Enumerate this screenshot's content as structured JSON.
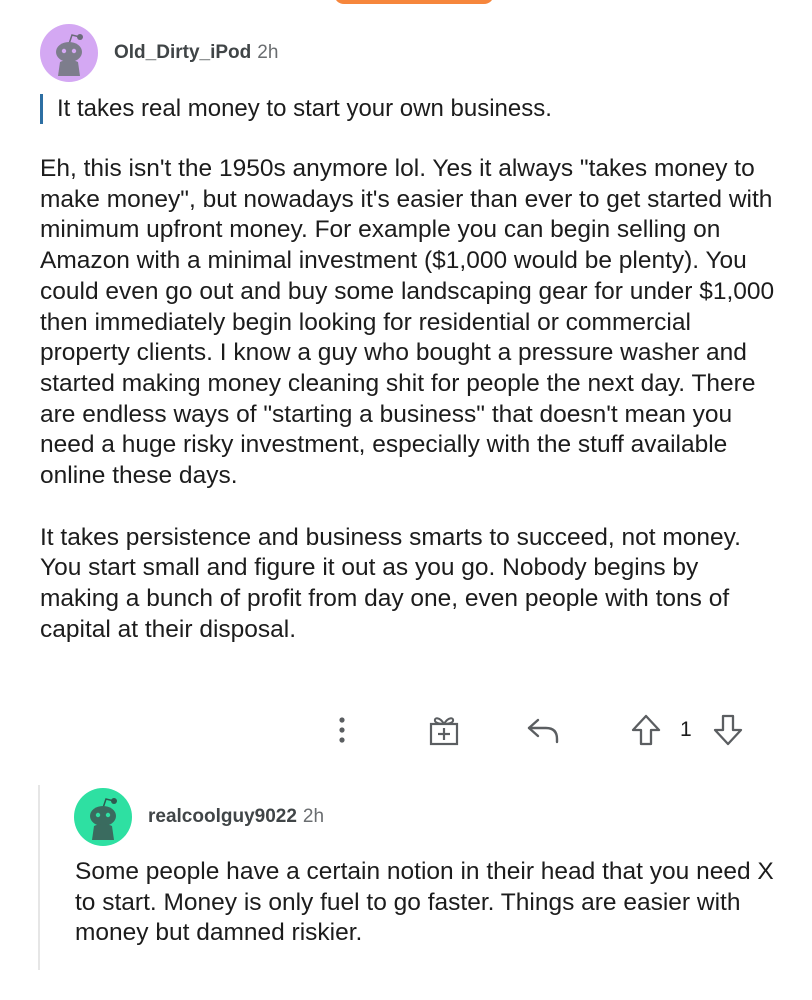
{
  "comments": [
    {
      "username": "Old_Dirty_iPod",
      "time": "2h",
      "avatar_color": "#d4a8f3",
      "quote": "It takes real money to start your own business.",
      "paragraphs": [
        "Eh, this isn't the 1950s anymore lol.  Yes it always \"takes money to make money\", but nowadays it's easier than ever to get started with minimum upfront money.  For example you can begin selling on Amazon with a minimal investment ($1,000 would be plenty).  You could even go out and buy some landscaping gear for under $1,000 then immediately begin looking for residential or commercial property clients.  I know a guy who bought a pressure washer and started making money cleaning shit for people the next day.  There are endless ways of \"starting a business\" that doesn't mean you need a huge risky investment, especially with the stuff available online these days.",
        "It takes persistence and business smarts to succeed, not money.  You start small and figure it out as you go.  Nobody begins by making a bunch of profit from day one, even people with tons of capital at their disposal."
      ],
      "actions": {
        "more_icon": "more-vertical-icon",
        "award_icon": "gift-award-icon",
        "reply_icon": "reply-arrow-icon",
        "upvote_icon": "upvote-arrow-icon",
        "vote_count": "1",
        "downvote_icon": "downvote-arrow-icon"
      }
    },
    {
      "username": "realcoolguy9022",
      "time": "2h",
      "avatar_color": "#2ee0a2",
      "paragraphs": [
        "Some people have a certain notion in their head that you need X to start.  Money is only fuel to go faster.  Things are easier with money but damned riskier."
      ]
    }
  ]
}
